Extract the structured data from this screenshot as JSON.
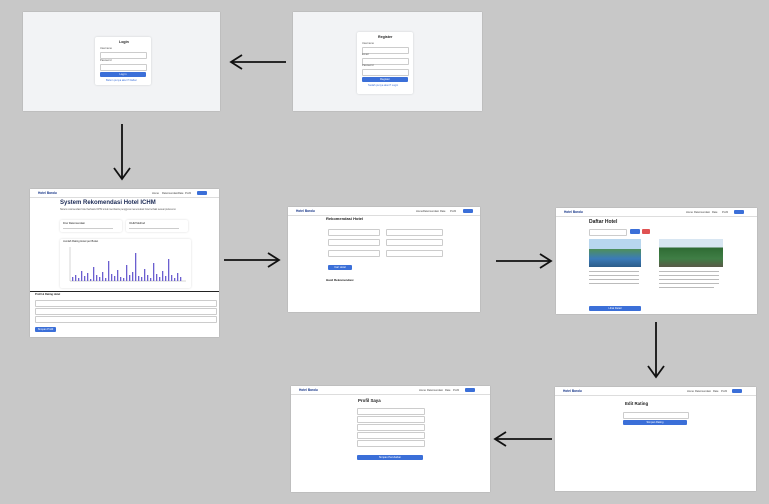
{
  "brand": "Hotel Bandu",
  "nav": {
    "home": "Home",
    "recommend": "Rekomendasi",
    "rate": "Rate",
    "profil": "Profil"
  },
  "login": {
    "title": "Login",
    "username": "Username",
    "password": "Password",
    "button": "Log in",
    "link": "Belum punya akun? Daftar"
  },
  "register": {
    "title": "Register",
    "username": "Username",
    "email": "Email",
    "password": "Password",
    "button": "Register",
    "link": "Sudah punya akun? Login"
  },
  "home": {
    "title": "System Rekomendasi Hotel ICHM",
    "subtitle": "Sistem rekomendasi hotel berbasis ICHM untuk membantu pengguna menemukan hotel terbaik sesuai preferensi.",
    "card1_title": "Fitur Rekomendasi",
    "card2_title": "ICHM Method",
    "chart_title": "Jumlah Rating Hotel per Bulan",
    "form_title": "Profil & Rating Hotel",
    "button": "Simpan Profil"
  },
  "recommend": {
    "title": "Rekomendasi Hotel",
    "button": "Cari Hotel Rekomendasi",
    "result": "Hasil Rekomendasi"
  },
  "detail": {
    "title": "Daftar Hotel",
    "search": "Cari nama hotel",
    "button": "Lihat Detail"
  },
  "rating": {
    "title": "Edit Rating",
    "button": "Simpan Rating"
  },
  "profile": {
    "title": "Profil Saya",
    "button": "Simpan Perubahan"
  },
  "colors": {
    "accent": "#3b6fd8",
    "danger": "#e05252",
    "chart_bar": "#6b5fd0"
  }
}
